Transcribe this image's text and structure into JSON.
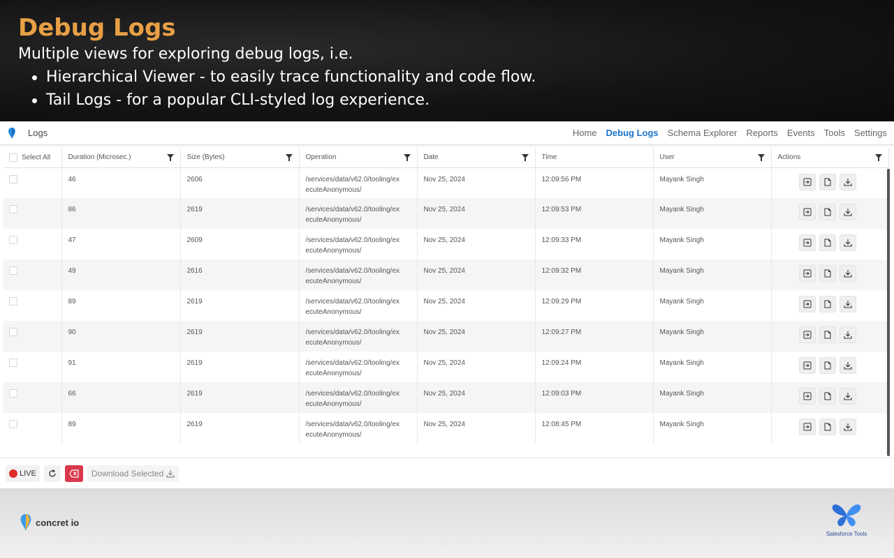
{
  "banner": {
    "title": "Debug Logs",
    "subtitle": "Multiple views for exploring debug logs, i.e.",
    "bullets": [
      "Hierarchical Viewer - to easily trace functionality and code flow.",
      "Tail Logs - for a popular CLI-styled log experience."
    ]
  },
  "navbar": {
    "title": "Logs",
    "links": [
      "Home",
      "Debug Logs",
      "Schema Explorer",
      "Reports",
      "Events",
      "Tools",
      "Settings"
    ],
    "active": "Debug Logs"
  },
  "table": {
    "select_all": "Select All",
    "columns": [
      "Duration (Microsec.)",
      "Size (Bytes)",
      "Operation",
      "Date",
      "Time",
      "User",
      "Actions"
    ],
    "rows": [
      {
        "duration": "46",
        "size": "2606",
        "op1": "/services/data/v62.0/tooling/ex",
        "op2": "ecuteAnonymous/",
        "date": "Nov 25, 2024",
        "time": "12:09:56 PM",
        "user": "Mayank Singh"
      },
      {
        "duration": "86",
        "size": "2619",
        "op1": "/services/data/v62.0/tooling/ex",
        "op2": "ecuteAnonymous/",
        "date": "Nov 25, 2024",
        "time": "12:09:53 PM",
        "user": "Mayank Singh"
      },
      {
        "duration": "47",
        "size": "2609",
        "op1": "/services/data/v62.0/tooling/ex",
        "op2": "ecuteAnonymous/",
        "date": "Nov 25, 2024",
        "time": "12:09:33 PM",
        "user": "Mayank Singh"
      },
      {
        "duration": "49",
        "size": "2616",
        "op1": "/services/data/v62.0/tooling/ex",
        "op2": "ecuteAnonymous/",
        "date": "Nov 25, 2024",
        "time": "12:09:32 PM",
        "user": "Mayank Singh"
      },
      {
        "duration": "89",
        "size": "2619",
        "op1": "/services/data/v62.0/tooling/ex",
        "op2": "ecuteAnonymous/",
        "date": "Nov 25, 2024",
        "time": "12:09:29 PM",
        "user": "Mayank Singh"
      },
      {
        "duration": "90",
        "size": "2619",
        "op1": "/services/data/v62.0/tooling/ex",
        "op2": "ecuteAnonymous/",
        "date": "Nov 25, 2024",
        "time": "12:09:27 PM",
        "user": "Mayank Singh"
      },
      {
        "duration": "91",
        "size": "2619",
        "op1": "/services/data/v62.0/tooling/ex",
        "op2": "ecuteAnonymous/",
        "date": "Nov 25, 2024",
        "time": "12:09:24 PM",
        "user": "Mayank Singh"
      },
      {
        "duration": "66",
        "size": "2619",
        "op1": "/services/data/v62.0/tooling/ex",
        "op2": "ecuteAnonymous/",
        "date": "Nov 25, 2024",
        "time": "12:09:03 PM",
        "user": "Mayank Singh"
      },
      {
        "duration": "89",
        "size": "2619",
        "op1": "/services/data/v62.0/tooling/ex",
        "op2": "ecuteAnonymous/",
        "date": "Nov 25, 2024",
        "time": "12:08:45 PM",
        "user": "Mayank Singh"
      }
    ],
    "row_action_icons": [
      "open-log-icon",
      "view-file-icon",
      "download-icon"
    ]
  },
  "footer": {
    "live_label": "LIVE",
    "download_label": "Download Selected",
    "icons": [
      "refresh-icon",
      "clear-logs-icon",
      "download-icon"
    ]
  },
  "branding": {
    "left_logo": "concret io",
    "right_logo": "Salesforce Tools",
    "right_logo_icon": "butterfly-logo-icon"
  },
  "colors": {
    "title_orange": "#e8a045",
    "nav_active": "#1a73c8",
    "live_red": "#e02b2b",
    "clear_red": "#d9384b",
    "brand_blue": "#2c6fd6"
  }
}
